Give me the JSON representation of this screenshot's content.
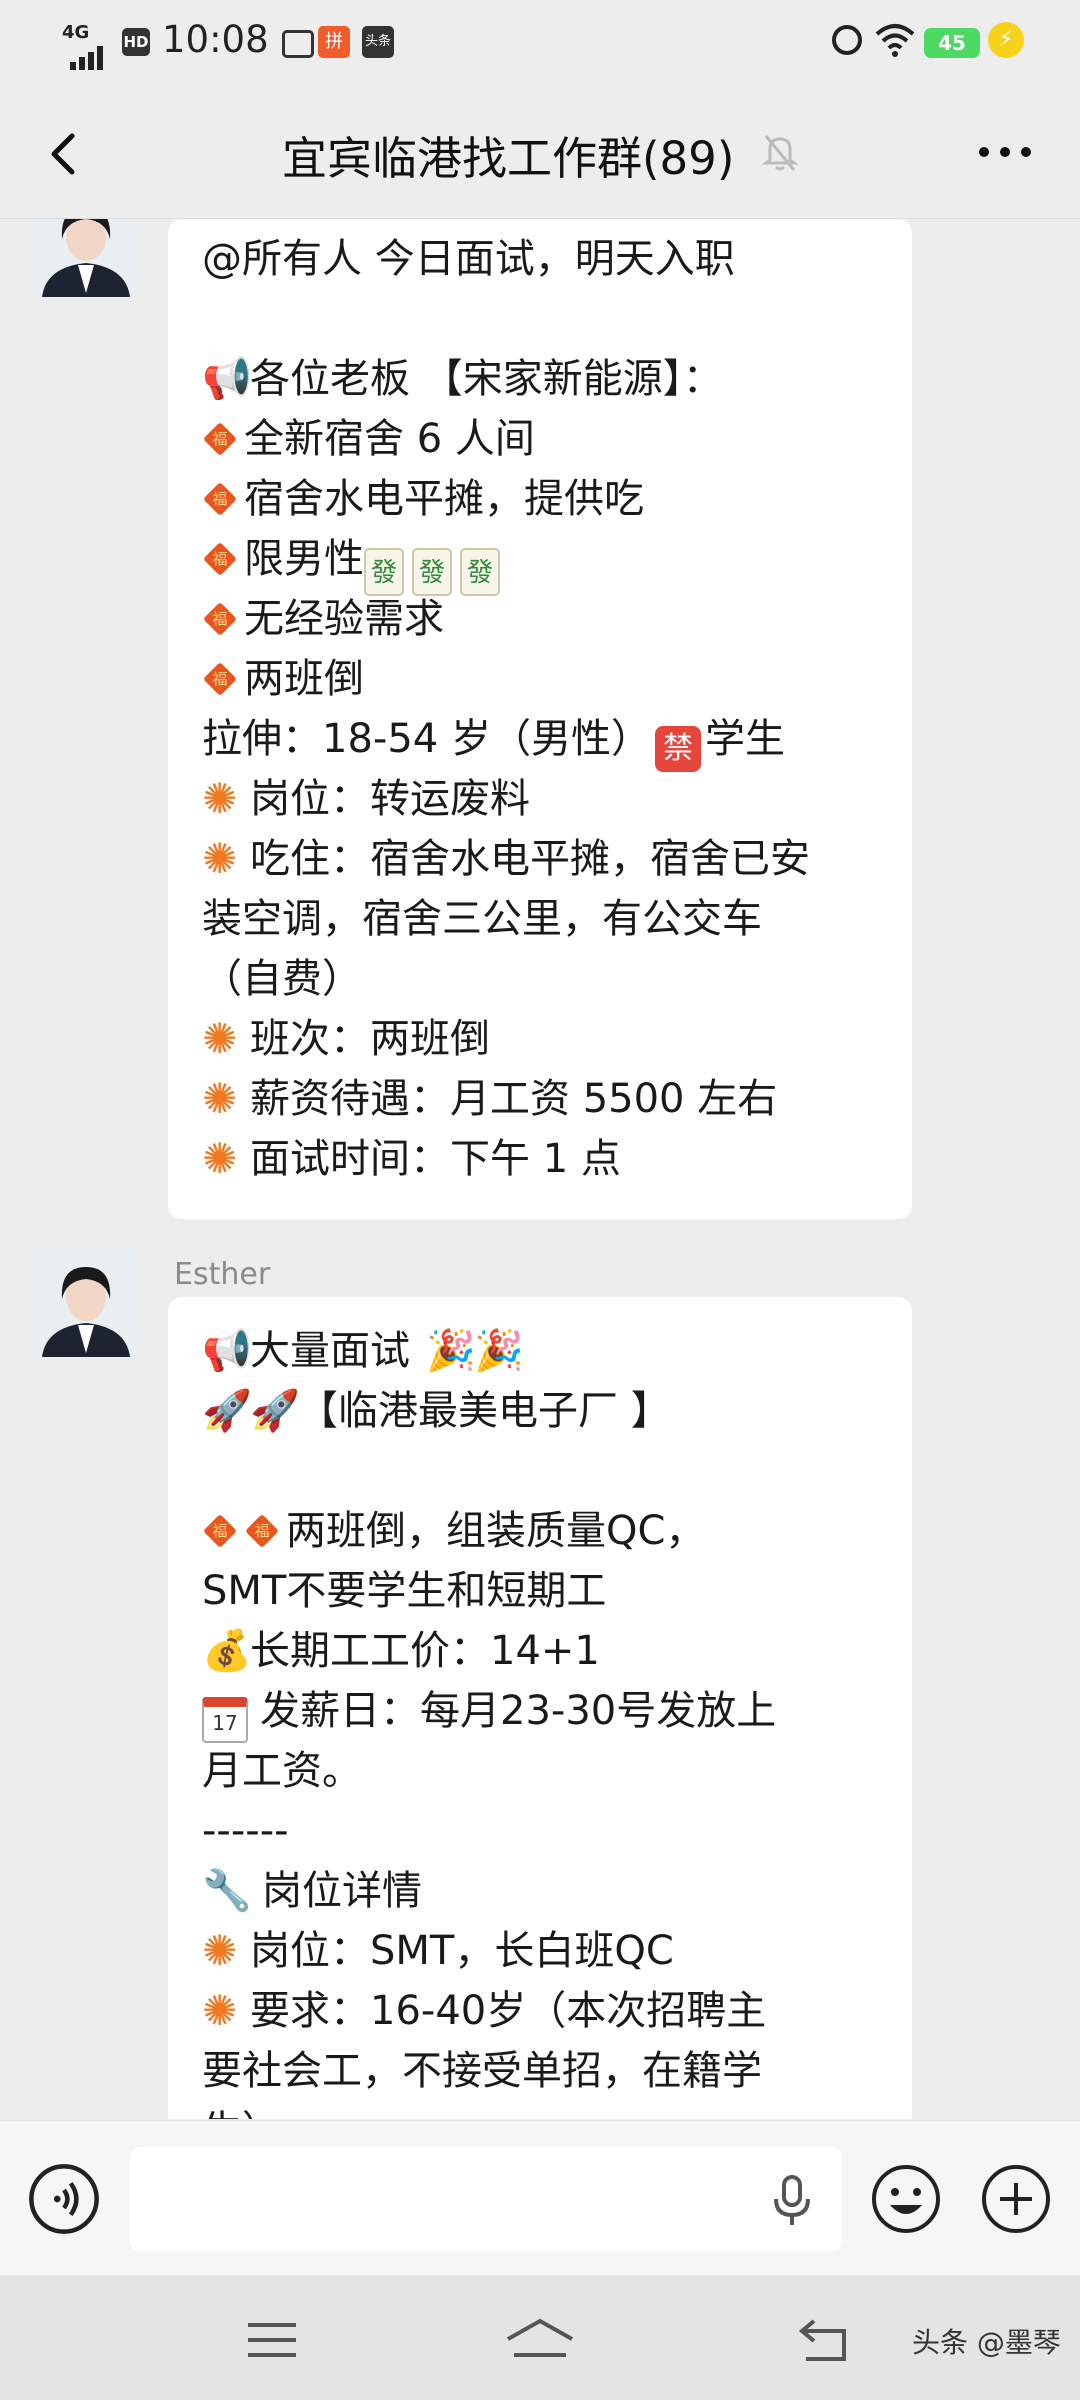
{
  "status_bar": {
    "network": "4G",
    "hd": "HD",
    "time": "10:08",
    "app_badge": "头条",
    "battery": "45"
  },
  "header": {
    "title": "宜宾临港找工作群(89)"
  },
  "messages": [
    {
      "sender": "",
      "lines": [
        "@所有人  今日面试，明天入职",
        "",
        "各位老板 【宋家新能源】：",
        "全新宿舍 6 人间",
        "宿舍水电平摊，提供吃",
        "限男性",
        "无经验需求",
        "两班倒",
        "拉伸：18-54 岁（男性）",
        "学生",
        "岗位：转运废料",
        "吃住：宿舍水电平摊，宿舍已安",
        "装空调，宿舍三公里，有公交车",
        "（自费）",
        "班次：两班倒",
        "薪资待遇：月工资 5500 左右",
        "面试时间：下午 1 点"
      ],
      "tile_char": "發",
      "ban_char": "禁"
    },
    {
      "sender": "Esther",
      "lines": [
        "大量面试",
        "【临港最美电子厂 】",
        "",
        "两班倒，组装质量QC，",
        "SMT不要学生和短期工",
        "长期工工价：14+1",
        "发薪日：每月23-30号发放上",
        "月工资。",
        "------",
        "岗位详情",
        "岗位：SMT，长白班QC",
        "要求：16-40岁（本次招聘主",
        "要社会工，不接受单招，在籍学",
        "生）"
      ],
      "calendar_day": "17"
    }
  ],
  "input": {
    "placeholder": ""
  },
  "watermark": "头条 @墨琴",
  "colors": {
    "background": "#ededed",
    "bubble": "#ffffff",
    "accent_diamond": "#e8561e",
    "battery": "#4cd964"
  }
}
